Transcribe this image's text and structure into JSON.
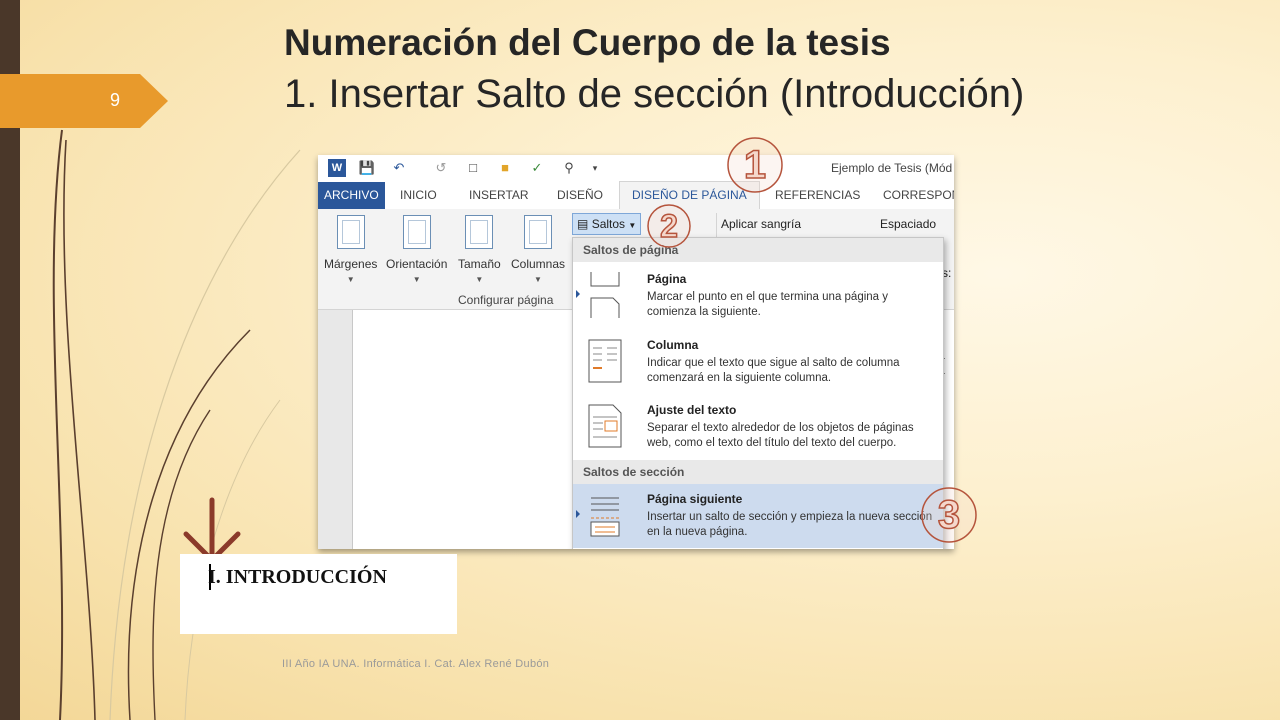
{
  "slide": {
    "number": "9",
    "title_line1": "Numeración del Cuerpo de la tesis",
    "title_line2": "1. Insertar Salto de sección (Introducción)",
    "footer": "III Año IA UNA. Informática I. Cat. Alex René Dubón"
  },
  "word": {
    "doc_title": "Ejemplo de Tesis (Mód",
    "qat_icons": [
      "word-logo-icon",
      "save-icon",
      "undo-icon",
      "redo-icon",
      "new-document-icon",
      "open-folder-icon",
      "spellcheck-icon",
      "print-preview-icon",
      "customize-qat-icon"
    ],
    "tabs": {
      "archivo": "ARCHIVO",
      "inicio": "INICIO",
      "insertar": "INSERTAR",
      "diseno": "DISEÑO",
      "diseno_pagina": "DISEÑO DE PÁGINA",
      "referencias": "REFERENCIAS",
      "correspondencia": "CORRESPON"
    },
    "ribbon": {
      "margenes": "Márgenes",
      "orientacion": "Orientación",
      "tamano": "Tamaño",
      "columnas": "Columnas",
      "group_label": "Configurar página",
      "saltos": "Saltos",
      "aplicar_sangria": "Aplicar sangría",
      "espaciado": "Espaciado",
      "partial_right": "És:"
    },
    "doc_fragment": "I",
    "dropdown": {
      "header_page": "Saltos de página",
      "header_section": "Saltos de sección",
      "items": [
        {
          "title": "Página",
          "desc": "Marcar el punto en el que termina una página y comienza la siguiente."
        },
        {
          "title": "Columna",
          "desc": "Indicar que el texto que sigue al salto de columna comenzará en la siguiente columna."
        },
        {
          "title": "Ajuste del texto",
          "desc": "Separar el texto alrededor de los objetos de páginas web, como el texto del título del texto del cuerpo."
        },
        {
          "title": "Página siguiente",
          "desc": "Insertar un salto de sección y empieza la nueva sección en la nueva página."
        }
      ]
    }
  },
  "callouts": [
    "1",
    "2",
    "3"
  ],
  "intro": {
    "text": "I.  INTRODUCCIÓN"
  },
  "colors": {
    "accent_orange": "#e89a2c",
    "dark_bar": "#4a3729",
    "word_blue": "#2b579a",
    "callout_stroke": "#b5543c",
    "arrow_brown": "#8b3a2a"
  }
}
